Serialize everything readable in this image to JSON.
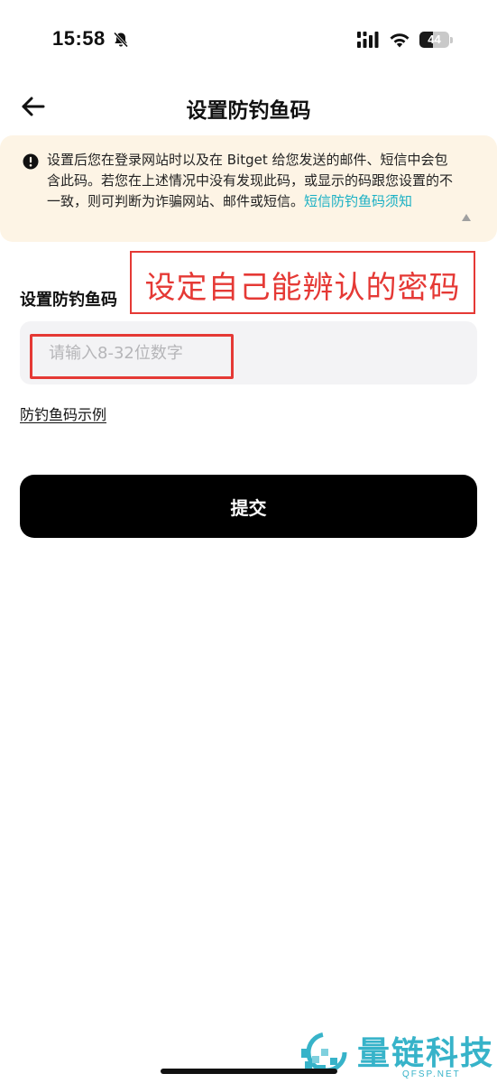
{
  "status_bar": {
    "time": "15:58",
    "battery_level": "44",
    "battery_fraction": 0.44,
    "icons": [
      "bell-slash-icon",
      "signal-icon",
      "wifi-icon",
      "battery-icon"
    ]
  },
  "header": {
    "title": "设置防钓鱼码",
    "back_icon": "arrow-left-icon"
  },
  "notice": {
    "icon": "exclamation-circle-icon",
    "text": "设置后您在登录网站时以及在 Bitget 给您发送的邮件、短信中会包含此码。若您在上述情况中没有发现此码，或显示的码跟您设置的不一致，则可判断为诈骗网站、邮件或短信。",
    "link": "短信防钓鱼码须知",
    "background": "#fdf4e5",
    "link_color": "#1ab0c4"
  },
  "form": {
    "label": "设置防钓鱼码",
    "input_value": "",
    "input_placeholder": "请输入8-32位数字",
    "example_link": "防钓鱼码示例",
    "submit_label": "提交"
  },
  "annotation": {
    "text": "设定自己能辨认的密码",
    "color": "#e53935"
  },
  "watermark": {
    "title": "量链科技",
    "subtitle": "QFSP.NET",
    "color": "#37b3c9"
  }
}
